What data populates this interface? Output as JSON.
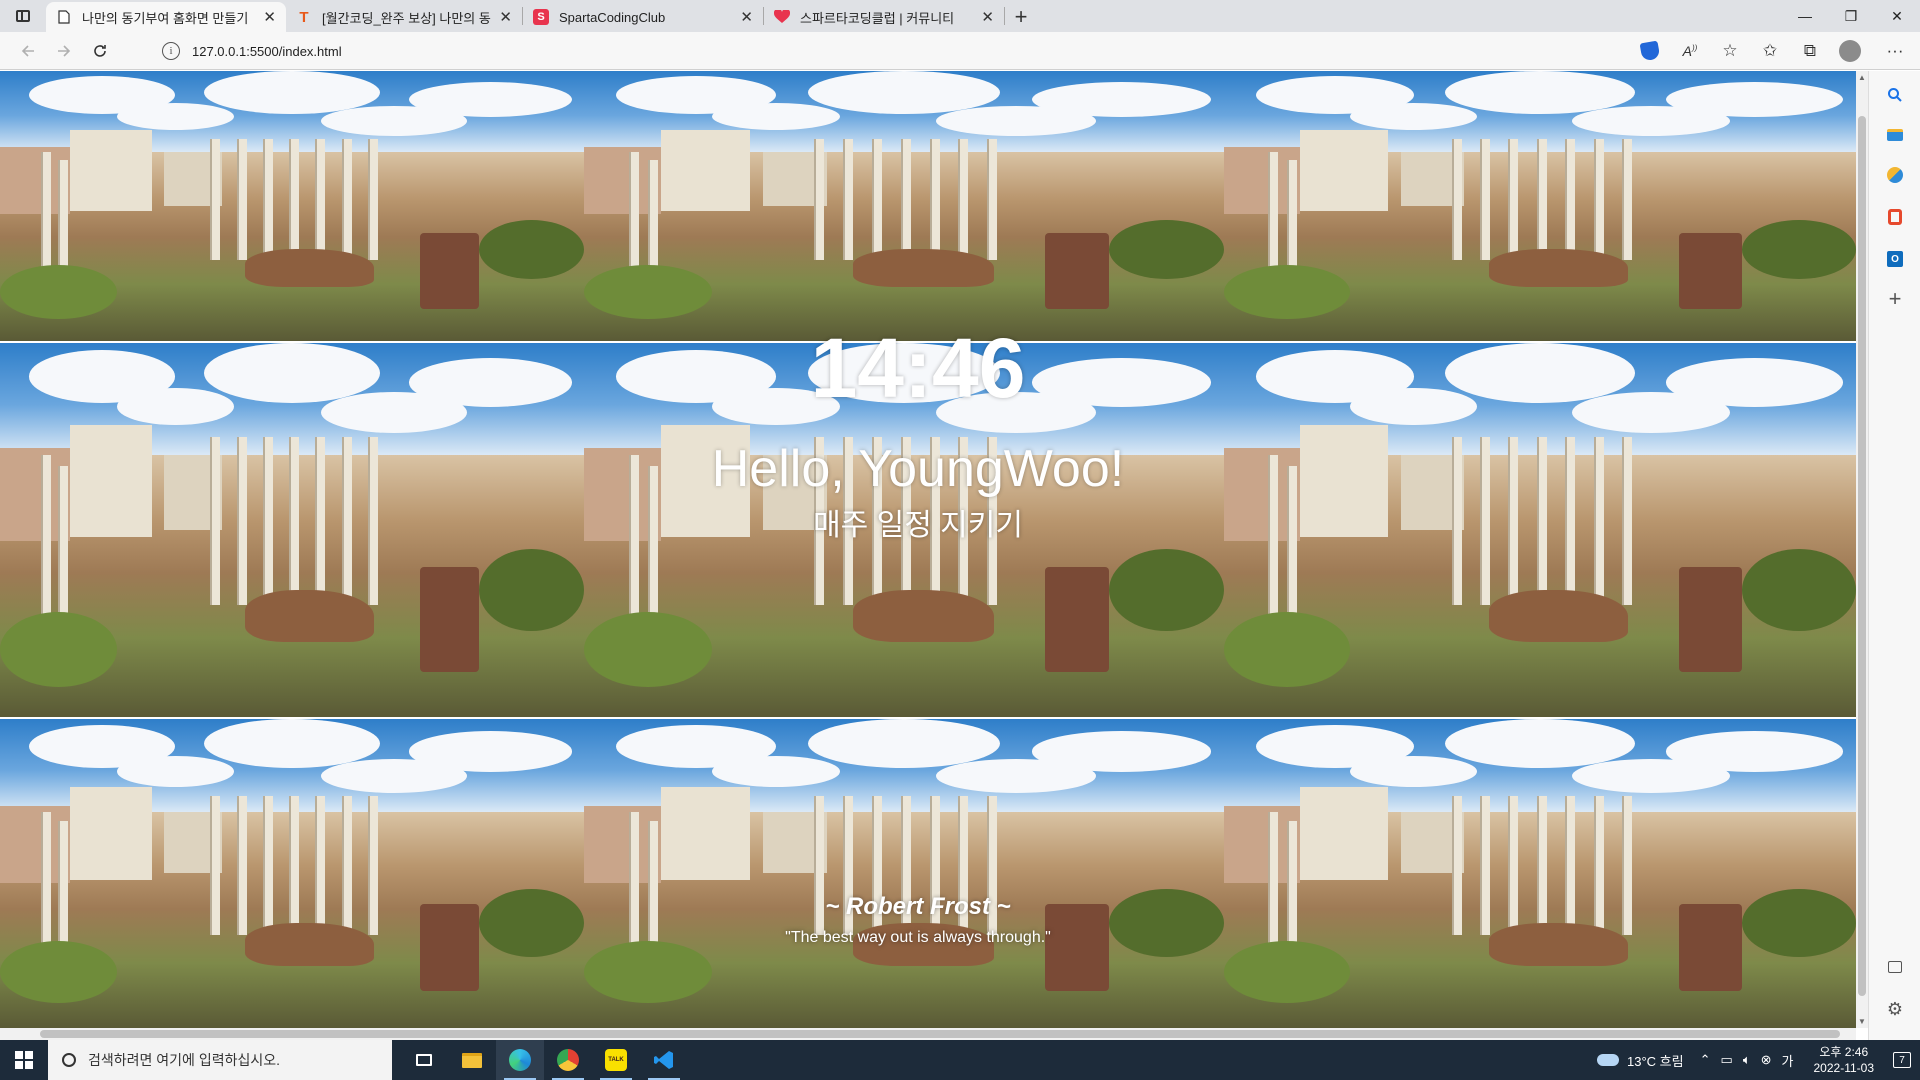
{
  "browser": {
    "tabs": [
      {
        "title": "나만의 동기부여 홈화면 만들기",
        "favicon": "page-icon",
        "active": true
      },
      {
        "title": "[월간코딩_완주 보상] 나만의 동기",
        "favicon": "t-logo",
        "active": false
      },
      {
        "title": "SpartaCodingClub",
        "favicon": "sparta-logo",
        "active": false
      },
      {
        "title": "스파르타코딩클럽 | 커뮤니티",
        "favicon": "sparta-heart-logo",
        "active": false
      }
    ],
    "close_glyph": "✕",
    "new_tab_glyph": "+",
    "window_controls": {
      "minimize": "—",
      "restore": "❐",
      "close": "✕"
    },
    "url": "127.0.0.1:5500/index.html",
    "info_glyph": "i"
  },
  "page": {
    "clock": "14:46",
    "greeting": "Hello, YoungWoo!",
    "todo": "매주 일정 지키기",
    "quote_author": "~ Robert Frost ~",
    "quote_text": "\"The best way out is always through.\"",
    "background": "roman-forum-photo-tiled"
  },
  "taskbar": {
    "search_placeholder": "검색하려면 여기에 입력하십시오.",
    "weather": "13°C  흐림",
    "time": "오후 2:46",
    "date": "2022-11-03",
    "notifications": "7"
  },
  "colors": {
    "tab_strip": "#dfe1e5",
    "toolbar": "#f7f7f7",
    "taskbar": "#1d2b3a",
    "edge_blue": "#2167d8"
  }
}
